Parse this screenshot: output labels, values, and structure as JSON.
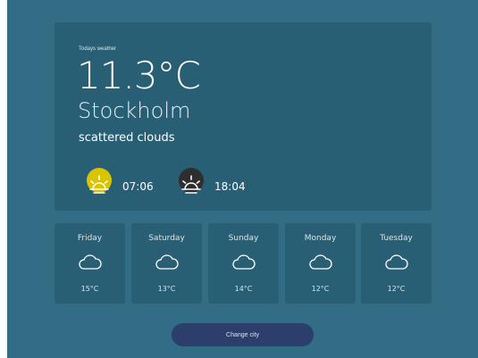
{
  "current": {
    "label": "Todays weather",
    "temperature": "11.3°C",
    "city": "Stockholm",
    "description": "scattered clouds",
    "sunrise": {
      "time": "07:06",
      "icon": "sunrise-icon",
      "color": "#d9c400"
    },
    "sunset": {
      "time": "18:04",
      "icon": "sunset-icon",
      "color": "#2e2e2e"
    }
  },
  "forecast": [
    {
      "day": "Friday",
      "temp": "15°C",
      "icon": "cloud-icon"
    },
    {
      "day": "Saturday",
      "temp": "13°C",
      "icon": "cloud-icon"
    },
    {
      "day": "Sunday",
      "temp": "14°C",
      "icon": "cloud-icon"
    },
    {
      "day": "Monday",
      "temp": "12°C",
      "icon": "cloud-icon"
    },
    {
      "day": "Tuesday",
      "temp": "12°C",
      "icon": "cloud-icon"
    }
  ],
  "actions": {
    "change_city_label": "Change city"
  },
  "colors": {
    "background": "#336c85",
    "card": "#285f74",
    "button": "#2c3e6b"
  }
}
